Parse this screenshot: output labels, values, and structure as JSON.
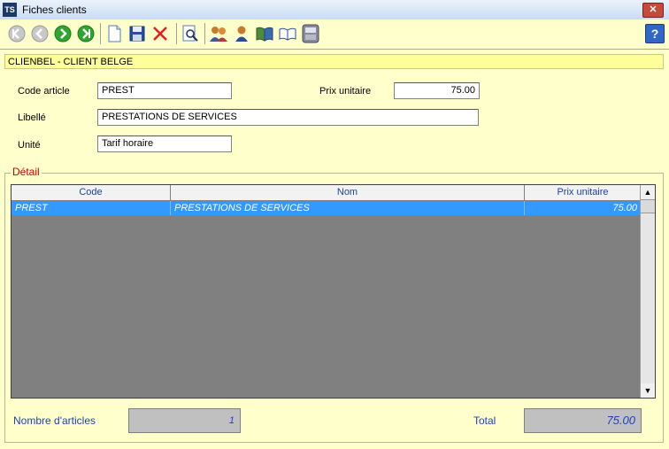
{
  "window": {
    "title": "Fiches clients",
    "app_icon": "TS"
  },
  "toolbar": {
    "icons": [
      "first-icon",
      "prev-icon",
      "next-icon",
      "last-icon",
      "new-icon",
      "save-icon",
      "delete-icon",
      "search-icon",
      "clients-icon",
      "contact-icon",
      "book-icon",
      "open-book-icon",
      "calc-icon"
    ],
    "help_label": "?"
  },
  "client_bar": {
    "text": "CLIENBEL - CLIENT BELGE"
  },
  "form": {
    "code_article_label": "Code article",
    "code_article_value": "PREST",
    "prix_unitaire_label": "Prix unitaire",
    "prix_unitaire_value": "75.00",
    "libelle_label": "Libellé",
    "libelle_value": "PRESTATIONS DE SERVICES",
    "unite_label": "Unité",
    "unite_value": "Tarif horaire"
  },
  "detail": {
    "legend": "Détail",
    "columns": [
      "Code",
      "Nom",
      "Prix unitaire"
    ],
    "rows": [
      {
        "code": "PREST",
        "nom": "PRESTATIONS DE SERVICES",
        "prix": "75.00"
      }
    ]
  },
  "footer": {
    "count_label": "Nombre d'articles",
    "count_value": "1",
    "total_label": "Total",
    "total_value": "75.00"
  },
  "colors": {
    "background": "#FFFFCC",
    "selection": "#3399FF",
    "accent": "#1F3FBF",
    "legend": "#CC0000"
  }
}
